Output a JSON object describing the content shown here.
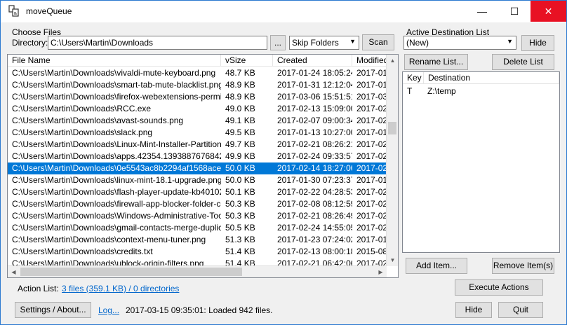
{
  "window": {
    "title": "moveQueue",
    "minimize": "—",
    "maximize": "☐",
    "close": "✕"
  },
  "choose_files": {
    "group_label": "Choose Files",
    "directory_label": "Directory:",
    "directory_value": "C:\\Users\\Martin\\Downloads",
    "browse_label": "...",
    "folder_mode": "Skip Folders",
    "scan_label": "Scan"
  },
  "file_list": {
    "columns": [
      "File Name",
      "vSize",
      "Created",
      "Modified"
    ],
    "rows": [
      {
        "name": "C:\\Users\\Martin\\Downloads\\vivaldi-mute-keyboard.png",
        "size": "48.7 KB",
        "created": "2017-01-24  18:05:24",
        "modified": "2017-01-"
      },
      {
        "name": "C:\\Users\\Martin\\Downloads\\smart-tab-mute-blacklist.png",
        "size": "48.9 KB",
        "created": "2017-01-31  12:12:04",
        "modified": "2017-01-"
      },
      {
        "name": "C:\\Users\\Martin\\Downloads\\firefox-webextensions-permissio...",
        "size": "48.9 KB",
        "created": "2017-03-06  15:51:51",
        "modified": "2017-03-"
      },
      {
        "name": "C:\\Users\\Martin\\Downloads\\RCC.exe",
        "size": "49.0 KB",
        "created": "2017-02-13  15:09:00",
        "modified": "2017-02-"
      },
      {
        "name": "C:\\Users\\Martin\\Downloads\\avast-sounds.png",
        "size": "49.1 KB",
        "created": "2017-02-07  09:00:34",
        "modified": "2017-02-"
      },
      {
        "name": "C:\\Users\\Martin\\Downloads\\slack.png",
        "size": "49.5 KB",
        "created": "2017-01-13  10:27:00",
        "modified": "2017-01-"
      },
      {
        "name": "C:\\Users\\Martin\\Downloads\\Linux-Mint-Installer-Partitions.png",
        "size": "49.7 KB",
        "created": "2017-02-21  08:26:21",
        "modified": "2017-02-"
      },
      {
        "name": "C:\\Users\\Martin\\Downloads\\apps.42354.13938876768421...",
        "size": "49.9 KB",
        "created": "2017-02-24  09:33:57",
        "modified": "2017-02-"
      },
      {
        "name": "C:\\Users\\Martin\\Downloads\\0e5543ac8b2294af1568aceb3...",
        "size": "50.0 KB",
        "created": "2017-02-14  18:27:06",
        "modified": "2017-02-",
        "selected": true
      },
      {
        "name": "C:\\Users\\Martin\\Downloads\\linux-mint-18.1-upgrade.png",
        "size": "50.0 KB",
        "created": "2017-01-30  07:23:37",
        "modified": "2017-01-"
      },
      {
        "name": "C:\\Users\\Martin\\Downloads\\flash-player-update-kb4010250...",
        "size": "50.1 KB",
        "created": "2017-02-22  04:28:53",
        "modified": "2017-02-"
      },
      {
        "name": "C:\\Users\\Martin\\Downloads\\firewall-app-blocker-folder-cont...",
        "size": "50.3 KB",
        "created": "2017-02-08  08:12:59",
        "modified": "2017-02-"
      },
      {
        "name": "C:\\Users\\Martin\\Downloads\\Windows-Administrative-Tools....",
        "size": "50.3 KB",
        "created": "2017-02-21  08:26:49",
        "modified": "2017-02-"
      },
      {
        "name": "C:\\Users\\Martin\\Downloads\\gmail-contacts-merge-duplicate...",
        "size": "50.5 KB",
        "created": "2017-02-24  14:55:05",
        "modified": "2017-02-"
      },
      {
        "name": "C:\\Users\\Martin\\Downloads\\context-menu-tuner.png",
        "size": "51.3 KB",
        "created": "2017-01-23  07:24:02",
        "modified": "2017-01-"
      },
      {
        "name": "C:\\Users\\Martin\\Downloads\\credits.txt",
        "size": "51.4 KB",
        "created": "2017-02-13  08:00:18",
        "modified": "2015-08-"
      },
      {
        "name": "C:\\Users\\Martin\\Downloads\\ublock-origin-filters.png",
        "size": "51.4 KB",
        "created": "2017-02-21  06:42:06",
        "modified": "2017-02-"
      }
    ]
  },
  "action_list": {
    "label": "Action List:",
    "summary": "3 files (359.1 KB) / 0 directories",
    "execute_label": "Execute Actions"
  },
  "destination": {
    "group_label": "Active Destination List",
    "selected_list": "(New)",
    "hide_label": "Hide",
    "rename_label": "Rename List...",
    "delete_label": "Delete List",
    "columns": [
      "Key",
      "Destination"
    ],
    "rows": [
      {
        "key": "T",
        "destination": "Z:\\temp"
      }
    ],
    "add_item_label": "Add Item...",
    "remove_item_label": "Remove Item(s)"
  },
  "footer": {
    "settings_label": "Settings / About...",
    "log_label": "Log...",
    "status": "2017-03-15 09:35:01: Loaded 942 files.",
    "hide_label": "Hide",
    "quit_label": "Quit"
  },
  "colors": {
    "accent": "#0078d7",
    "close_red": "#e81123",
    "link": "#0066cc"
  },
  "icons": [
    "app-icon",
    "minimize-icon",
    "maximize-icon",
    "close-icon",
    "dropdown-arrow-icon",
    "scroll-up-icon",
    "scroll-down-icon",
    "scroll-left-icon",
    "scroll-right-icon"
  ]
}
